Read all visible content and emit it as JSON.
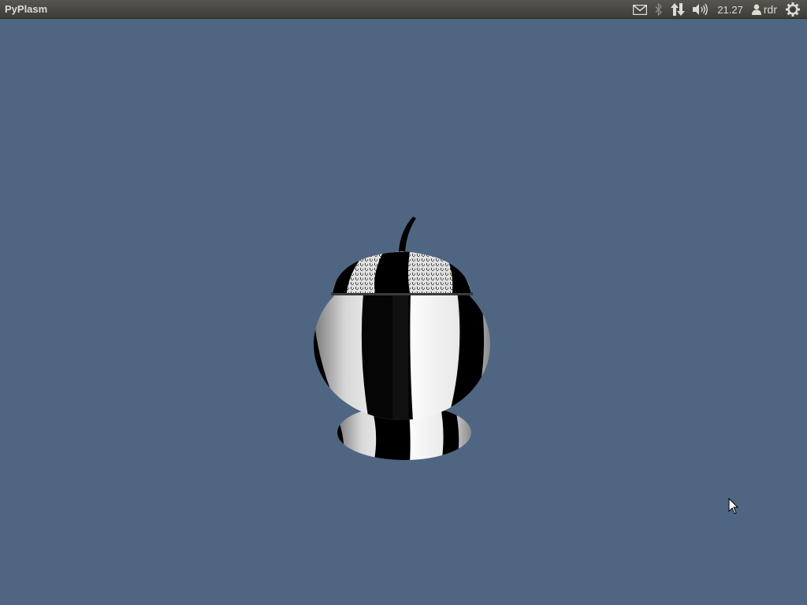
{
  "topbar": {
    "app_title": "PyPlasm",
    "indicators": {
      "mail_icon": "envelope-icon",
      "bluetooth_icon": "bluetooth-icon",
      "network_icon": "network-arrows-icon",
      "volume_icon": "speaker-icon",
      "clock": "21.27",
      "user_icon": "person-icon",
      "user_name": "rdr",
      "session_icon": "power-gear-icon"
    }
  },
  "viewport": {
    "background_color": "#4e6681",
    "model": "striped-sugar-bowl-3d-model"
  },
  "colors": {
    "panel": "#3d3c37",
    "panel_text": "#dfdbd2",
    "desktop": "#4e6681"
  }
}
